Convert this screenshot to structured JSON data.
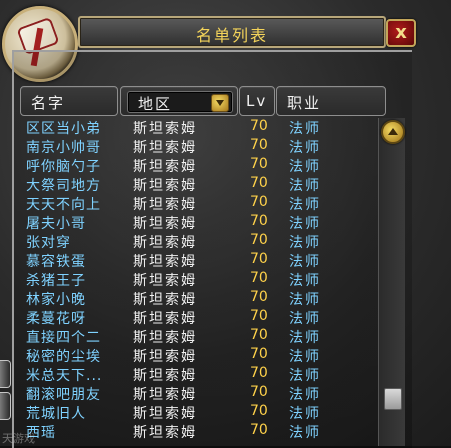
{
  "window": {
    "title": "名单列表",
    "close_label": "x"
  },
  "columns": {
    "name": "名字",
    "zone": "地区",
    "level": "Lv",
    "class": "职业"
  },
  "rows": [
    {
      "name": "区区当小弟",
      "zone": "斯坦索姆",
      "level": "70",
      "class": "法师"
    },
    {
      "name": "南京小帅哥",
      "zone": "斯坦索姆",
      "level": "70",
      "class": "法师"
    },
    {
      "name": "呼你脑勺子",
      "zone": "斯坦索姆",
      "level": "70",
      "class": "法师"
    },
    {
      "name": "大祭司地方",
      "zone": "斯坦索姆",
      "level": "70",
      "class": "法师"
    },
    {
      "name": "天天不向上",
      "zone": "斯坦索姆",
      "level": "70",
      "class": "法师"
    },
    {
      "name": "屠夫小哥",
      "zone": "斯坦索姆",
      "level": "70",
      "class": "法师"
    },
    {
      "name": "张对穿",
      "zone": "斯坦索姆",
      "level": "70",
      "class": "法师"
    },
    {
      "name": "慕容铁蛋",
      "zone": "斯坦索姆",
      "level": "70",
      "class": "法师"
    },
    {
      "name": "杀猪王子",
      "zone": "斯坦索姆",
      "level": "70",
      "class": "法师"
    },
    {
      "name": "林家小晚",
      "zone": "斯坦索姆",
      "level": "70",
      "class": "法师"
    },
    {
      "name": "柔蔓花呀",
      "zone": "斯坦索姆",
      "level": "70",
      "class": "法师"
    },
    {
      "name": "直接四个二",
      "zone": "斯坦索姆",
      "level": "70",
      "class": "法师"
    },
    {
      "name": "秘密的尘埃",
      "zone": "斯坦索姆",
      "level": "70",
      "class": "法师"
    },
    {
      "name": "米总天下...",
      "zone": "斯坦索姆",
      "level": "70",
      "class": "法师"
    },
    {
      "name": "翻滚吧朋友",
      "zone": "斯坦索姆",
      "level": "70",
      "class": "法师"
    },
    {
      "name": "荒城旧人",
      "zone": "斯坦索姆",
      "level": "70",
      "class": "法师"
    },
    {
      "name": "西瑶",
      "zone": "斯坦索姆",
      "level": "70",
      "class": "法师"
    }
  ],
  "watermark": "天游戏",
  "colors": {
    "name_text": "#7fd2ff",
    "zone_text": "#f0f0f0",
    "level_text": "#ffd24a",
    "title_text": "#f4d45a",
    "frame_gold": "#b8a77a"
  },
  "icons": {
    "portrait": "scroll-portrait-icon",
    "close": "close-icon",
    "dropdown": "dropdown-arrow-icon",
    "scroll_up": "scroll-up-arrow-icon"
  }
}
